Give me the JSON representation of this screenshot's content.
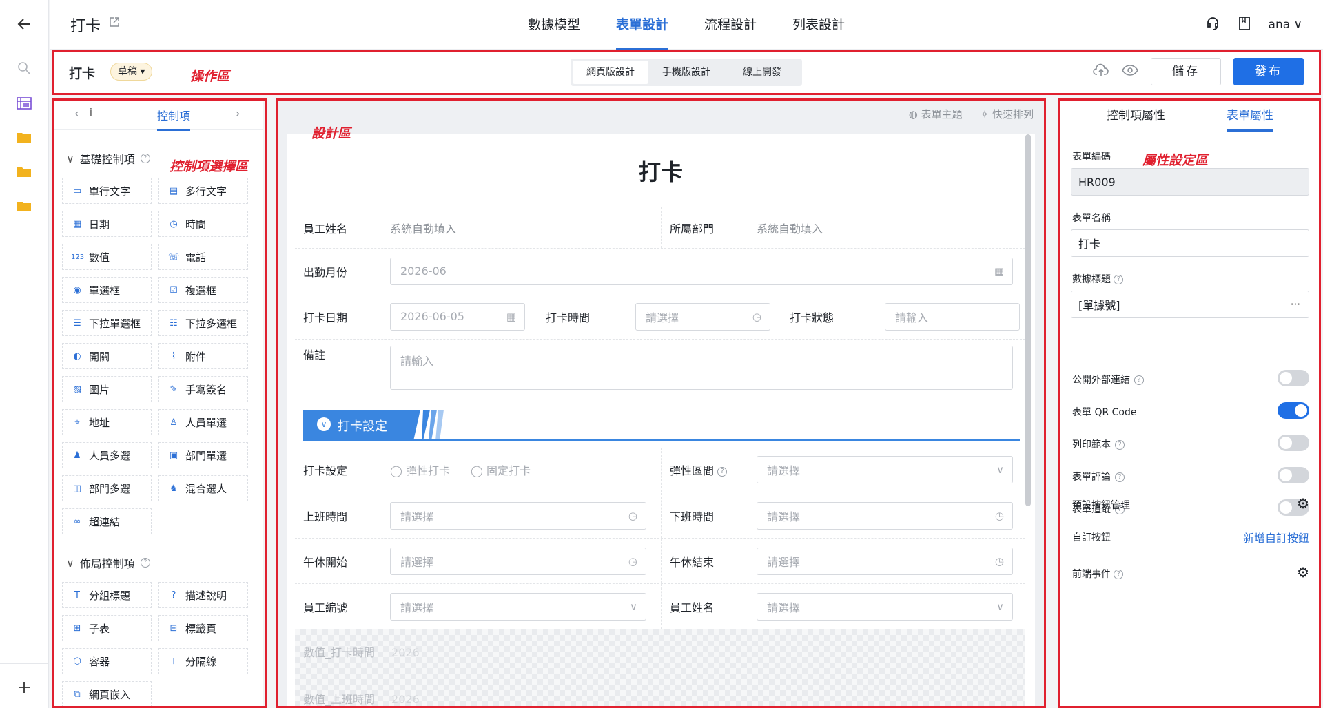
{
  "topbar": {
    "title": "打卡",
    "tabs": [
      "數據模型",
      "表單設計",
      "流程設計",
      "列表設計"
    ],
    "active_tab": "表單設計",
    "user": "ana"
  },
  "opbar": {
    "form_name": "打卡",
    "status_badge": "草稿",
    "zone_label": "操作區",
    "segments": [
      "網頁版設計",
      "手機版設計",
      "線上開發"
    ],
    "active_segment": "網頁版設計",
    "save_label": "儲存",
    "publish_label": "發布"
  },
  "left_panel": {
    "tab_label": "控制項",
    "zone_label": "控制項選擇區",
    "basic_section": "基礎控制項",
    "basic_controls": [
      {
        "label": "單行文字",
        "icon": "single-line-text-icon"
      },
      {
        "label": "多行文字",
        "icon": "multi-line-text-icon"
      },
      {
        "label": "日期",
        "icon": "calendar-icon"
      },
      {
        "label": "時間",
        "icon": "clock-icon"
      },
      {
        "label": "數值",
        "icon": "number-icon"
      },
      {
        "label": "電話",
        "icon": "phone-icon"
      },
      {
        "label": "單選框",
        "icon": "radio-icon"
      },
      {
        "label": "複選框",
        "icon": "checkbox-icon"
      },
      {
        "label": "下拉單選框",
        "icon": "dropdown-single-icon"
      },
      {
        "label": "下拉多選框",
        "icon": "dropdown-multi-icon"
      },
      {
        "label": "開關",
        "icon": "switch-icon"
      },
      {
        "label": "附件",
        "icon": "paperclip-icon"
      },
      {
        "label": "圖片",
        "icon": "image-icon"
      },
      {
        "label": "手寫簽名",
        "icon": "pen-icon"
      },
      {
        "label": "地址",
        "icon": "location-icon"
      },
      {
        "label": "人員單選",
        "icon": "user-icon"
      },
      {
        "label": "人員多選",
        "icon": "users-icon"
      },
      {
        "label": "部門單選",
        "icon": "department-icon"
      },
      {
        "label": "部門多選",
        "icon": "departments-icon"
      },
      {
        "label": "混合選人",
        "icon": "mixed-user-icon"
      },
      {
        "label": "超連結",
        "icon": "link-icon"
      }
    ],
    "layout_section": "佈局控制項",
    "layout_controls": [
      {
        "label": "分組標題",
        "icon": "text-t-icon"
      },
      {
        "label": "描述說明",
        "icon": "help-icon"
      },
      {
        "label": "子表",
        "icon": "table-icon"
      },
      {
        "label": "標籤頁",
        "icon": "tabs-icon"
      },
      {
        "label": "容器",
        "icon": "box-icon"
      },
      {
        "label": "分隔線",
        "icon": "divider-icon"
      },
      {
        "label": "網頁嵌入",
        "icon": "webpage-icon"
      }
    ]
  },
  "canvas": {
    "zone_label": "設計區",
    "theme_label": "表單主題",
    "arrange_label": "快速排列",
    "form_title": "打卡",
    "fields": {
      "employee_name": "員工姓名",
      "employee_name_value": "系統自動填入",
      "department": "所屬部門",
      "department_value": "系統自動填入",
      "month": "出勤月份",
      "month_value": "2026-06",
      "date": "打卡日期",
      "date_value": "2026-06-05",
      "time": "打卡時間",
      "time_ph": "請選擇",
      "status": "打卡狀態",
      "status_ph": "請輸入",
      "remark": "備註",
      "remark_ph": "請輸入"
    },
    "group_title": "打卡設定",
    "settings": {
      "punch_setting": "打卡設定",
      "opt_flexible": "彈性打卡",
      "opt_fixed": "固定打卡",
      "flex_range": "彈性區間",
      "flex_ph": "請選擇",
      "work_start": "上班時間",
      "work_end": "下班時間",
      "lunch_start": "午休開始",
      "lunch_end": "午休結束",
      "emp_no": "員工編號",
      "emp_name": "員工姓名",
      "ph": "請選擇"
    },
    "hidden_fields": [
      "數值_打卡時間",
      "數值_上班時間"
    ],
    "hidden_values": [
      "2026",
      "2026"
    ]
  },
  "right_panel": {
    "tabs": [
      "控制項屬性",
      "表單屬性"
    ],
    "active_tab": "表單屬性",
    "zone_label": "屬性設定區",
    "form_code_label": "表單編碼",
    "form_code": "HR009",
    "form_name_label": "表單名稱",
    "form_name": "打卡",
    "data_title_label": "數據標題",
    "data_title": "[單據號]",
    "toggles": [
      {
        "label": "公開外部連結",
        "on": false,
        "help": true
      },
      {
        "label": "表單 QR Code",
        "on": true,
        "help": false
      },
      {
        "label": "列印範本",
        "on": false,
        "help": true
      },
      {
        "label": "表單評論",
        "on": false,
        "help": true
      },
      {
        "label": "表單追蹤",
        "on": false,
        "help": true
      }
    ],
    "default_buttons_label": "預設按鈕管理",
    "custom_buttons_label": "自訂按鈕",
    "add_custom_button": "新增自訂按鈕",
    "frontend_events_label": "前端事件"
  },
  "colors": {
    "accent": "#1f6fe5",
    "annotation": "#e0202f",
    "badge_bg": "#fdf4df"
  }
}
